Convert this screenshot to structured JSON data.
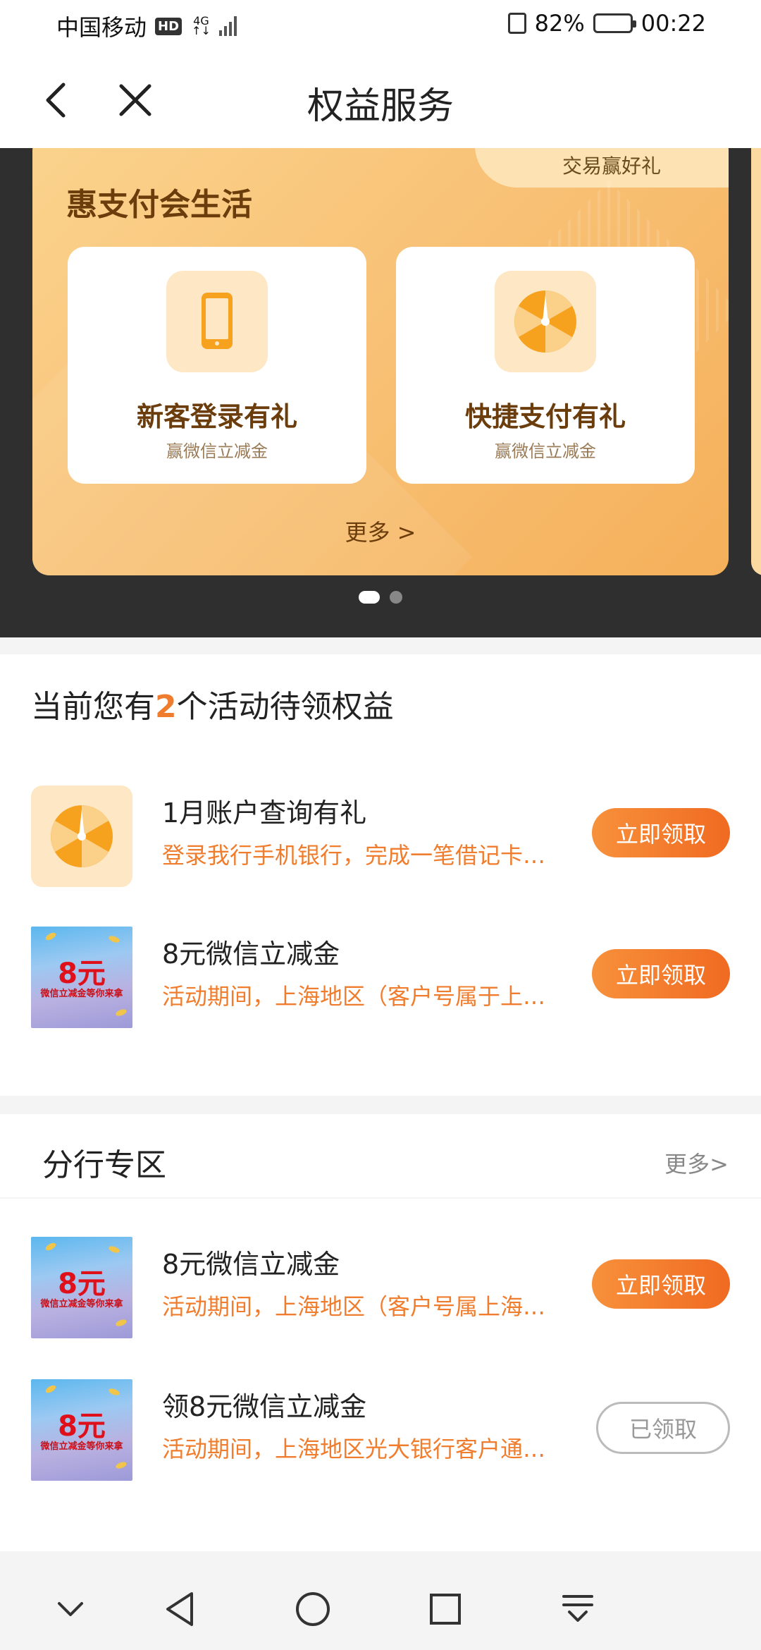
{
  "status_bar": {
    "carrier": "中国移动",
    "hd": "HD",
    "network_top": "4G",
    "network_bottom": "↑↓",
    "battery_percent": "82%",
    "battery_level": 0.82,
    "time": "00:22"
  },
  "nav": {
    "title": "权益服务",
    "back_icon": "chevron-left-icon",
    "close_icon": "close-icon"
  },
  "banner": {
    "corner_label": "交易赢好礼",
    "title": "惠支付会生活",
    "tiles": [
      {
        "title": "新客登录有礼",
        "subtitle": "赢微信立减金",
        "icon": "phone-icon"
      },
      {
        "title": "快捷支付有礼",
        "subtitle": "赢微信立减金",
        "icon": "wheel-icon"
      }
    ],
    "more": "更多 >",
    "page_count": 2,
    "active_page": 1
  },
  "pending": {
    "heading_prefix": "当前您有",
    "count": "2",
    "heading_suffix": "个活动待领权益",
    "items": [
      {
        "title": "1月账户查询有礼",
        "desc": "登录我行手机银行，完成一笔借记卡账户查询…",
        "button": "立即领取",
        "thumb": "wheel-icon"
      },
      {
        "title": "8元微信立减金",
        "desc": "活动期间，上海地区（客户号属于上海分行…",
        "button": "立即领取",
        "thumb_big": "8元",
        "thumb_small": "微信立减金等你来拿"
      }
    ]
  },
  "branch": {
    "title": "分行专区",
    "more": "更多>",
    "items": [
      {
        "title": "8元微信立减金",
        "desc": "活动期间，上海地区（客户号属上海分行…",
        "button": "立即领取",
        "thumb_big": "8元",
        "thumb_small": "微信立减金等你来拿"
      },
      {
        "title": "领8元微信立减金",
        "desc": "活动期间，上海地区光大银行客户通过…",
        "button": "已领取",
        "thumb_big": "8元",
        "thumb_small": "微信立减金等你来拿"
      }
    ]
  },
  "system_nav": {
    "icons": [
      "chevron-down-icon",
      "back-triangle-icon",
      "home-circle-icon",
      "recents-square-icon",
      "download-icon"
    ]
  },
  "colors": {
    "accent": "#f07d2d",
    "banner_gold": "#f8c277",
    "banner_text": "#6b3d0c"
  }
}
